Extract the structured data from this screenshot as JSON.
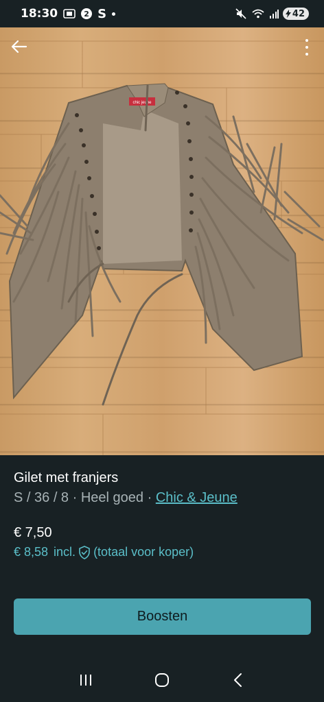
{
  "status_bar": {
    "time": "18:30",
    "badge_number": "2",
    "letter": "S",
    "battery": "42"
  },
  "product": {
    "title": "Gilet met franjers",
    "size": "S / 36 / 8",
    "separator1": " · ",
    "condition": "Heel goed",
    "separator2": " · ",
    "brand": "Chic & Jeune",
    "price": "€ 7,50",
    "total_price": "€ 8,58",
    "incl_label": "incl.",
    "total_note": "(totaal voor koper)",
    "label_text": "chic jeune"
  },
  "actions": {
    "boost_label": "Boosten"
  },
  "colors": {
    "background": "#182124",
    "accent": "#5bbfc9",
    "button": "#4ba4b0"
  }
}
